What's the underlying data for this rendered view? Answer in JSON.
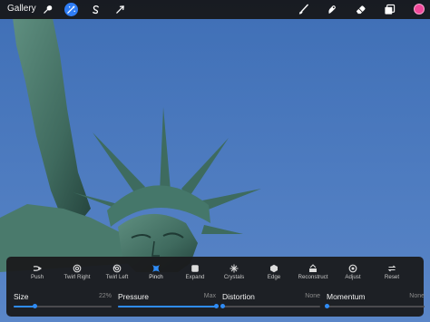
{
  "toolbar": {
    "gallery_label": "Gallery",
    "left_tools": [
      {
        "icon": "wrench-icon",
        "active": false
      },
      {
        "icon": "magic-wand-icon",
        "active": true
      },
      {
        "icon": "selection-s-icon",
        "active": false
      },
      {
        "icon": "arrow-cursor-icon",
        "active": false
      }
    ],
    "right_tools": [
      "brush-icon",
      "smudge-icon",
      "eraser-icon",
      "layers-icon"
    ],
    "current_color": "#f0489a",
    "accent_color": "#2f7df6"
  },
  "liquify": {
    "modes": [
      {
        "label": "Push",
        "icon": "push-icon"
      },
      {
        "label": "Twirl Right",
        "icon": "twirl-right-icon"
      },
      {
        "label": "Twirl Left",
        "icon": "twirl-left-icon"
      },
      {
        "label": "Pinch",
        "icon": "pinch-icon",
        "selected": true
      },
      {
        "label": "Expand",
        "icon": "expand-icon"
      },
      {
        "label": "Crystals",
        "icon": "crystals-icon"
      },
      {
        "label": "Edge",
        "icon": "edge-icon"
      },
      {
        "label": "Reconstruct",
        "icon": "reconstruct-icon"
      },
      {
        "label": "Adjust",
        "icon": "adjust-icon"
      },
      {
        "label": "Reset",
        "icon": "reset-icon"
      }
    ],
    "sliders": [
      {
        "label": "Size",
        "value_text": "22%",
        "value": 0.22
      },
      {
        "label": "Pressure",
        "value_text": "Max",
        "value": 1.0
      },
      {
        "label": "Distortion",
        "value_text": "None",
        "value": 0.0
      },
      {
        "label": "Momentum",
        "value_text": "None",
        "value": 0.0
      }
    ]
  }
}
